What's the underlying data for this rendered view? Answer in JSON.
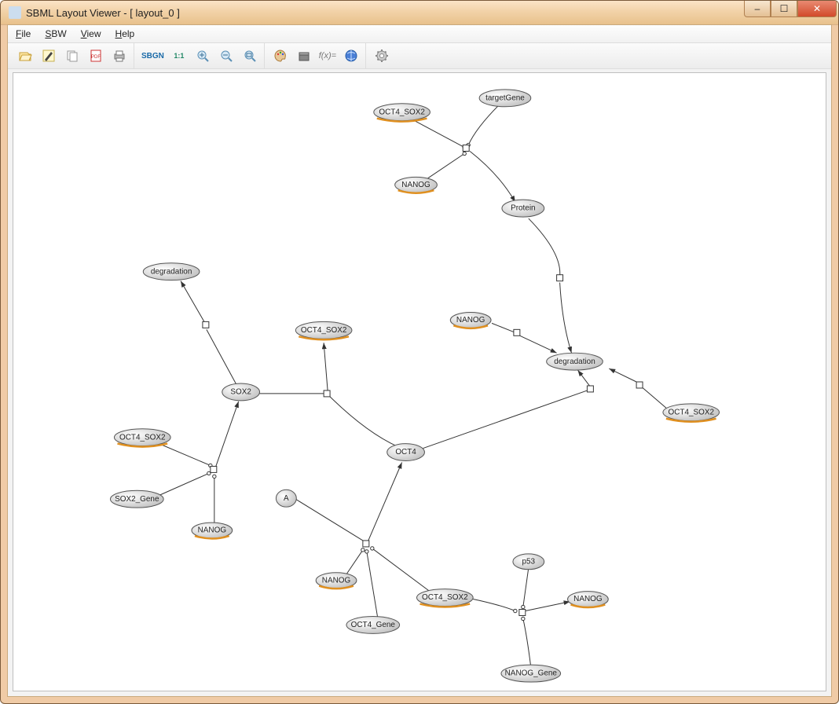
{
  "window": {
    "title": "SBML Layout Viewer - [ layout_0 ]",
    "min_btn": "–",
    "max_btn": "☐",
    "close_btn": "✕"
  },
  "menu": {
    "file": "File",
    "sbw": "SBW",
    "view": "View",
    "help": "Help"
  },
  "toolbar": {
    "sbgn": "SBGN",
    "fit": "1:1"
  },
  "graph": {
    "nodes": {
      "oct4sox2_top": "OCT4_SOX2",
      "targetGene": "targetGene",
      "nanog_top": "NANOG",
      "protein": "Protein",
      "degradation_left": "degradation",
      "sox2": "SOX2",
      "oct4sox2_mid": "OCT4_SOX2",
      "nanog_mid": "NANOG",
      "degradation_right": "degradation",
      "oct4sox2_right": "OCT4_SOX2",
      "oct4": "OCT4",
      "oct4sox2_l2": "OCT4_SOX2",
      "sox2_gene": "SOX2_Gene",
      "nanog_l": "NANOG",
      "a_node": "A",
      "nanog_b": "NANOG",
      "oct4sox2_b": "OCT4_SOX2",
      "oct4_gene": "OCT4_Gene",
      "p53": "p53",
      "nanog_r": "NANOG",
      "nanog_gene": "NANOG_Gene"
    }
  }
}
